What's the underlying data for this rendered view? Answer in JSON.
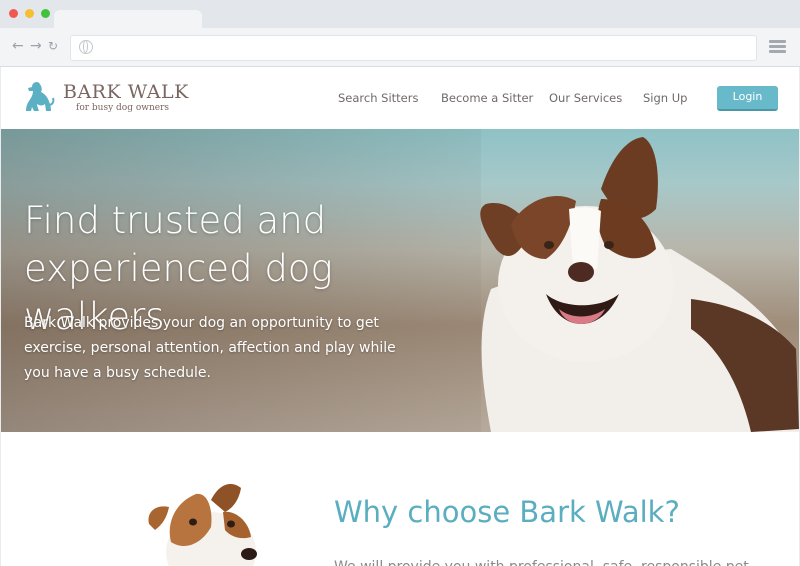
{
  "site": {
    "brand": "BARK WALK",
    "tagline": "for busy dog owners",
    "nav": [
      "Search Sitters",
      "Become a Sitter",
      "Our Services",
      "Sign Up"
    ],
    "login_label": "Login"
  },
  "hero": {
    "title": "Find trusted and experienced dog walkers",
    "text": "Bark Walk provides your dog an opportunity to get exercise, personal attention, affection and play while you have a busy schedule."
  },
  "why": {
    "title": "Why choose Bark Walk?",
    "text": "We will provide you with professional, safe, responsible pet"
  },
  "colors": {
    "accent": "#68b9c9",
    "brand": "#7a6660",
    "heading": "#5aaebf"
  }
}
